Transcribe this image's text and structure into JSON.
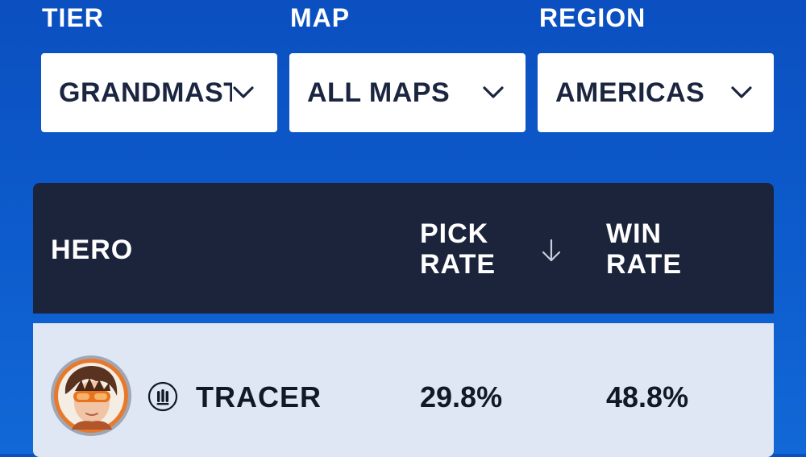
{
  "filters": {
    "tier": {
      "label": "TIER",
      "value": "GRANDMASTER"
    },
    "map": {
      "label": "MAP",
      "value": "ALL MAPS"
    },
    "region": {
      "label": "REGION",
      "value": "AMERICAS"
    }
  },
  "table": {
    "columns": {
      "hero": "HERO",
      "pick_rate_line1": "PICK",
      "pick_rate_line2": "RATE",
      "win_rate_line1": "WIN",
      "win_rate_line2": "RATE"
    },
    "sort_icon": "arrow-down-icon",
    "rows": [
      {
        "hero": "TRACER",
        "role_icon": "damage-role-icon",
        "pick_rate": "29.8%",
        "win_rate": "48.8%"
      }
    ]
  },
  "colors": {
    "background": "#0b4fc0",
    "header": "#1c243c",
    "row": "#dfe7f4"
  }
}
